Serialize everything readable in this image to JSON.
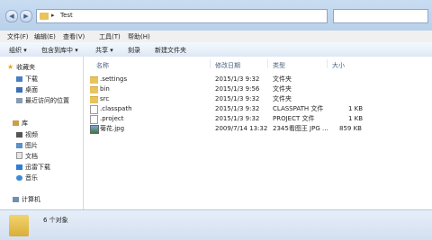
{
  "address": {
    "path": "Test"
  },
  "menu": [
    "文件(F)",
    "编辑(E)",
    "查看(V)",
    "工具(T)",
    "帮助(H)"
  ],
  "toolbar": {
    "organize": "组织 ▾",
    "include": "包含到库中 ▾",
    "share": "共享 ▾",
    "burn": "刻录",
    "new_folder": "新建文件夹"
  },
  "sidebar": {
    "favorites": "收藏夹",
    "fav_items": [
      "下载",
      "桌面",
      "最近访问的位置"
    ],
    "libraries": "库",
    "lib_items": [
      "视频",
      "图片",
      "文档",
      "迅雷下载",
      "音乐"
    ],
    "computer": "计算机"
  },
  "columns": {
    "name": "名称",
    "date": "修改日期",
    "type": "类型",
    "size": "大小"
  },
  "files": [
    {
      "name": ".settings",
      "date": "2015/1/3 9:32",
      "type": "文件夹",
      "size": "",
      "icon": "folder"
    },
    {
      "name": "bin",
      "date": "2015/1/3 9:56",
      "type": "文件夹",
      "size": "",
      "icon": "folder"
    },
    {
      "name": "src",
      "date": "2015/1/3 9:32",
      "type": "文件夹",
      "size": "",
      "icon": "folder"
    },
    {
      "name": ".classpath",
      "date": "2015/1/3 9:32",
      "type": "CLASSPATH 文件",
      "size": "1 KB",
      "icon": "file"
    },
    {
      "name": ".project",
      "date": "2015/1/3 9:32",
      "type": "PROJECT 文件",
      "size": "1 KB",
      "icon": "file"
    },
    {
      "name": "菊花.jpg",
      "date": "2009/7/14 13:32",
      "type": "2345看图王 JPG ...",
      "size": "859 KB",
      "icon": "image"
    }
  ],
  "status": {
    "count": "6 个对象"
  }
}
